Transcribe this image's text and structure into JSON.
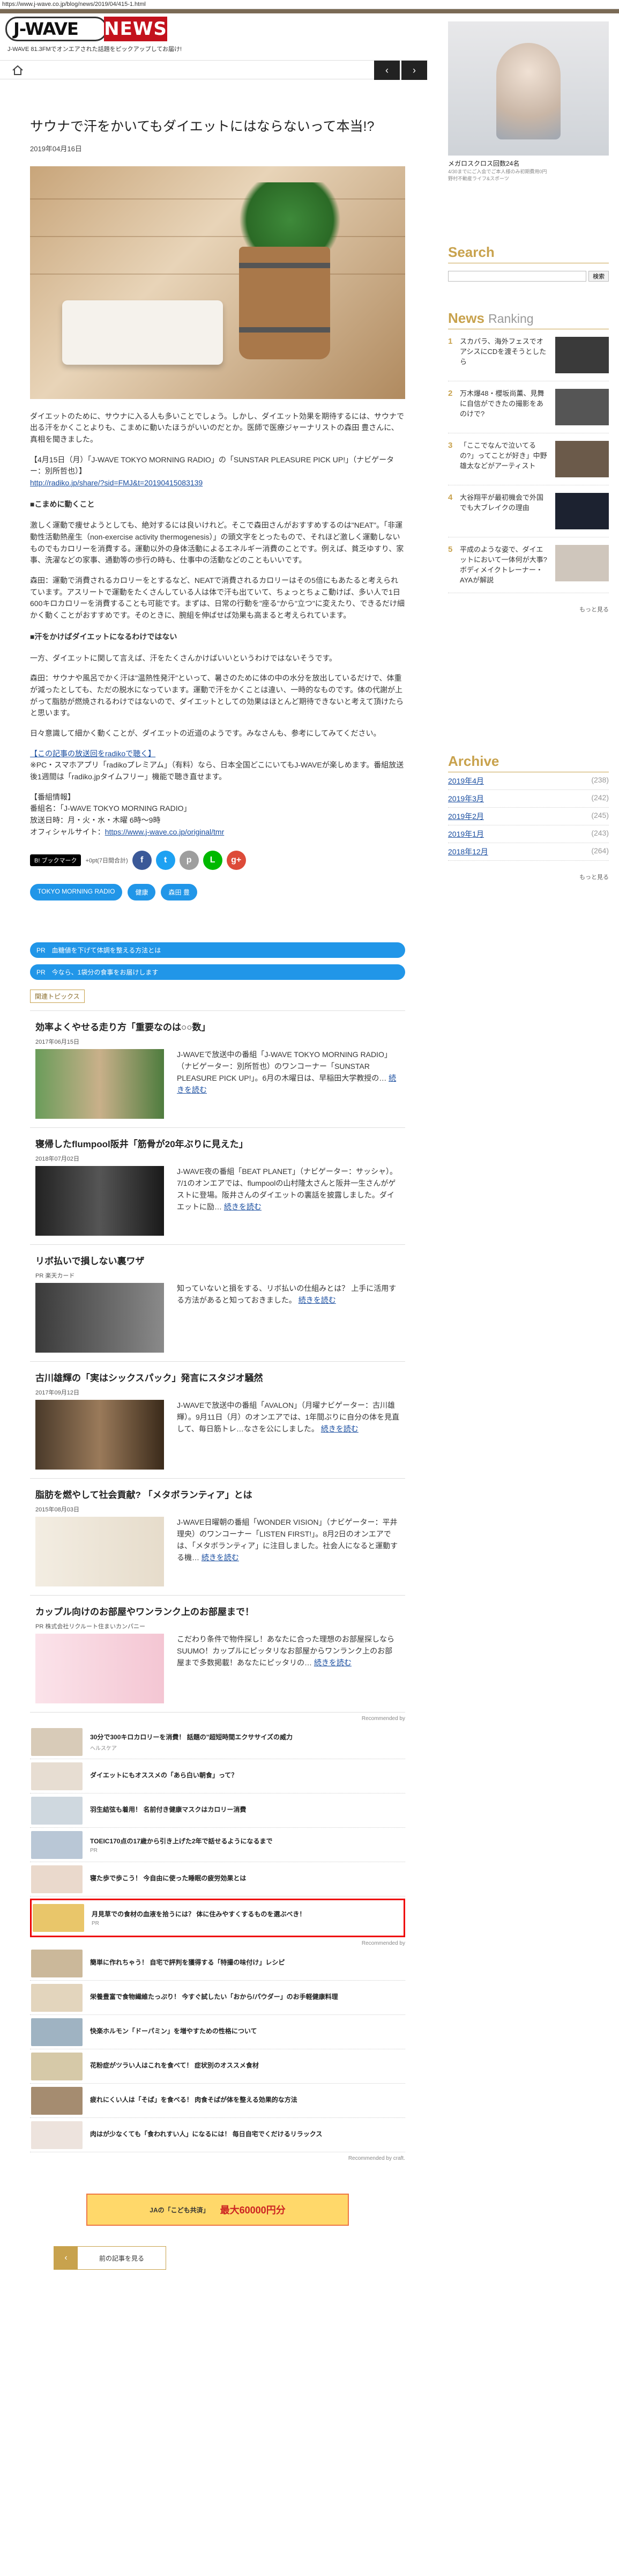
{
  "browser": {
    "url": "https://www.j-wave.co.jp/blog/news/2019/04/415-1.html"
  },
  "header": {
    "logo_jwave": "J-WAVE",
    "logo_news": "NEWS",
    "tagline": "J-WAVE 81.3FMでオンエアされた話題をピックアップしてお届け!"
  },
  "nav": {
    "prev": "‹",
    "next": "›"
  },
  "article": {
    "title": "サウナで汗をかいてもダイエットにはならないって本当!?",
    "date": "2019年04月16日",
    "paragraphs": [
      "ダイエットのために、サウナに入る人も多いことでしょう。しかし、ダイエット効果を期待するには、サウナで出る汗をかくことよりも、こまめに動いたほうがいいのだとか。医師で医療ジャーナリストの森田 豊さんに、真相を聞きました。",
      "【4月15日（月）「J-WAVE TOKYO MORNING RADIO」の「SUNSTAR PLEASURE PICK UP!」（ナビゲーター：別所哲也）】",
      "http://radiko.jp/share/?sid=FMJ&t=20190415083139"
    ],
    "h_1": "■こまめに動くこと",
    "p_1a": "激しく運動で痩せようとしても、絶対するには良いけれど。そこで森田さんがおすすめするのは\"NEAT\"。「非運動性活動熱産生（non-exercise activity thermogenesis）」の頭文字をとったもので、それほど激しく運動しないものでもカロリーを消費する。運動以外の身体活動によるエネルギー消費のことです。例えば、貧乏ゆすり、家事、洗濯などの家事、通勤等の歩行の時も、仕事中の活動などのこともいいです。",
    "p_1b": "森田：運動で消費されるカロリーをとするなど、NEATで消費されるカロリーはその5倍にもあたると考えられています。アスリートで運動をたくさんしている人は体で汗も出ていて、ちょっとちょこ動けば、多い人で1日600キロカロリーを消費することも可能です。まずは、日常の行動を\"座る\"から\"立つ\"に変えたり、できるだけ細かく動くことがおすすめです。そのときに、腕組を伸ばせば効果も高まると考えられています。",
    "h_2": "■汗をかけばダイエットになるわけではない",
    "p_2a": "一方、ダイエットに関して言えば、汗をたくさんかけばいいというわけではないそうです。",
    "p_2b": "森田：サウナや風呂でかく汗は\"温熱性発汗\"といって、暑さのために体の中の水分を放出しているだけで、体重が減ったとしても、ただの脱水になっています。運動で汗をかくことは違い、一時的なものです。体の代謝が上がって脂肪が燃焼されるわけではないので、ダイエットとしての効果はほとんど期待できないと考えて頂けたらと思います。",
    "p_2c": "日々意識して細かく動くことが、ダイエットの近道のようです。みなさんも、参考にしてみてください。",
    "radiko_link": "【この記事の放送回をradikoで聴く】",
    "radiko_note": "※PC・スマホアプリ「radikoプレミアム」（有料）なら、日本全国どこにいてもJ-WAVEが楽しめます。番組放送後1週間は「radiko.jpタイムフリー」機能で聴き直せます。",
    "program": [
      "【番組情報】",
      "番組名：「J-WAVE TOKYO MORNING RADIO」",
      "放送日時：月・火・水・木曜 6時～9時"
    ],
    "site_label": "オフィシャルサイト：",
    "site_url": "https://www.j-wave.co.jp/original/tmr"
  },
  "share": {
    "bookmark": "B! ブックマーク",
    "count": "+0pt(7日間合計)"
  },
  "tags": [
    "TOKYO MORNING RADIO",
    "健康",
    "森田 豊"
  ],
  "pr": [
    "PR　血糖値を下げて体調を整える方法とは",
    "PR　今なら、1袋分の食事をお届けします"
  ],
  "related_label": "関連トピックス",
  "related": [
    {
      "title": "効率よくやせる走り方「重要なのは○○数」",
      "date": "2017年06月15日",
      "text": "J-WAVEで放送中の番組「J-WAVE TOKYO MORNING RADIO」（ナビゲーター：別所哲也）のワンコーナー「SUNSTAR PLEASURE PICK UP!」。6月の木曜日は、早稲田大学教授の…",
      "more": "続きを読む"
    },
    {
      "title": "寝帰したflumpool阪井「筋骨が20年ぶりに見えた」",
      "date": "2018年07月02日",
      "text": "J-WAVE夜の番組「BEAT PLANET」（ナビゲーター：サッシャ）。7/1のオンエアでは、flumpoolの山村隆太さんと阪井一生さんがゲストに登場。阪井さんのダイエットの裏話を披露しました。ダイエットに励…",
      "more": "続きを読む"
    },
    {
      "title": "リボ払いで損しない裏ワザ",
      "date": "PR 楽天カード",
      "text": "知っていないと損をする、リボ払いの仕組みとは？ 上手に活用する方法があると知っておきました。",
      "more": "続きを読む"
    },
    {
      "title": "古川雄輝の「実はシックスパック」発言にスタジオ騒然",
      "date": "2017年09月12日",
      "text": "J-WAVEで放送中の番組「AVALON」（月曜ナビゲーター：古川雄輝）。9月11日（月）のオンエアでは、1年間ぶりに自分の体を見直して、毎日筋トレ…なさを公にしました。",
      "more": "続きを読む"
    },
    {
      "title": "脂肪を燃やして社会貢献? 「メタボランティア」とは",
      "date": "2015年08月03日",
      "text": "J-WAVE日曜朝の番組「WONDER VISION」（ナビゲーター：平井理央）のワンコーナー「LISTEN FIRST!」。8月2日のオンエアでは、「メタボランティア」に注目しました。社会人になると運動する機…",
      "more": "続きを読む"
    },
    {
      "title": "カップル向けのお部屋やワンランク上のお部屋まで！",
      "date": "PR 株式会社リクルート住まいカンパニー",
      "text": "こだわり条件で物件探し！あなたに合った理想のお部屋探しならSUUMO！カップルにピッタリなお部屋からワンランク上のお部屋まで多数掲載！あなたにピッタリの…",
      "more": "続きを読む"
    }
  ],
  "recs": [
    {
      "title": "30分で300キロカロリーを消費！ 話題の\"超短時間エクササイズの威力",
      "src": "ヘルスケア"
    },
    {
      "title": "ダイエットにもオススメの「あら白い朝食」って？",
      "src": ""
    },
    {
      "title": "羽生結弦も着用！ 名前付き健康マスクはカロリー消費",
      "src": ""
    },
    {
      "title": "TOEIC170点の17歳から引き上げた2年で話せるようになるまで",
      "src": "PR"
    },
    {
      "title": "寝た歩で歩こう！ 今自由に使った睡眠の疲労効果とは",
      "src": ""
    },
    {
      "title": "月見草での食材の血液を拾うには？ 体に住みやすくするものを選ぶべき！",
      "src": "PR"
    },
    {
      "title": "簡単に作れちゃう！ 自宅で評判を獲得する「特撮の味付け」レシピ",
      "src": ""
    },
    {
      "title": "栄養豊富で食物繊維たっぷり！ 今すぐ試したい「おから/パウダー」のお手軽健康料理",
      "src": ""
    },
    {
      "title": "快楽ホルモン「ドーパミン」を増やすための性格について",
      "src": ""
    },
    {
      "title": "花粉症がツラい人はこれを食べて！ 症状別のオススメ食材",
      "src": ""
    },
    {
      "title": "疲れにくい人は「そば」を食べる！ 肉食そばが体を整える効果的な方法",
      "src": ""
    },
    {
      "title": "肉はが少なくても「食われすい人」になるには！ 毎日自宅でくだけるリラックス",
      "src": ""
    }
  ],
  "rec_labels": {
    "top": "Recommended by",
    "mid": "Recommended by",
    "bottom": "Recommended by craft."
  },
  "banner": {
    "text": "最大60000円分",
    "sub": "JAの「こども共済」"
  },
  "back_button": "前の記事を見る",
  "sidebar": {
    "ad_caption": "メガロスクロス回数24名",
    "ad_sub": "4/30までにご入会でご本人様のみ初期費用0円",
    "ad_source": "野村不動産ライフ&スポーツ",
    "search_title": "Search",
    "search_button": "検索",
    "ranking_title": "News",
    "ranking_title2": "Ranking",
    "ranking": [
      {
        "n": "1",
        "text": "スカパラ、海外フェスでオアシスにCDを渡そうとしたら"
      },
      {
        "n": "2",
        "text": "万木爆48・櫻坂尚薫、見舞に自信ができたの撮影をあのけで?"
      },
      {
        "n": "3",
        "text": "「ここでなんで泣いてるの?」ってことが好き」中野雄太などがアーティスト"
      },
      {
        "n": "4",
        "text": "大谷翔平が最初機会で外国でも大ブレイクの理由"
      },
      {
        "n": "5",
        "text": "平成のような姿で、ダイエットにおいて一体何が大事? ボディメイクトレーナー・AYAが解説"
      }
    ],
    "more": "もっと見る",
    "archive_title": "Archive",
    "archive": [
      {
        "label": "2019年4月",
        "count": "(238)"
      },
      {
        "label": "2019年3月",
        "count": "(242)"
      },
      {
        "label": "2019年2月",
        "count": "(245)"
      },
      {
        "label": "2019年1月",
        "count": "(243)"
      },
      {
        "label": "2018年12月",
        "count": "(264)"
      }
    ],
    "archive_more": "もっと見る"
  }
}
